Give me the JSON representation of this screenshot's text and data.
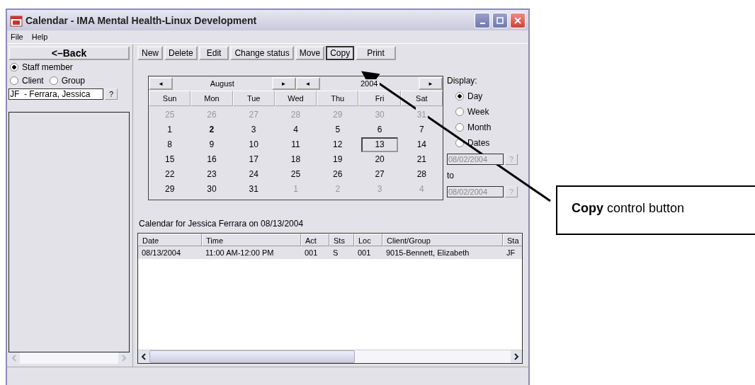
{
  "window": {
    "title": "Calendar - IMA Mental Health-Linux Development"
  },
  "menu": [
    "File",
    "Help"
  ],
  "back_button": "<–Back",
  "toolbar": [
    {
      "label": "New",
      "selected": false
    },
    {
      "label": "Delete",
      "selected": false
    },
    {
      "label": "Edit",
      "selected": false
    },
    {
      "label": "Change status",
      "selected": false
    },
    {
      "label": "Move",
      "selected": false
    },
    {
      "label": "Copy",
      "selected": true
    },
    {
      "label": "Print",
      "selected": false
    }
  ],
  "mode_options": [
    {
      "label": "Staff member",
      "selected": true
    },
    {
      "label": "Client",
      "selected": false
    },
    {
      "label": "Group",
      "selected": false
    }
  ],
  "person_field": {
    "value": "JF  - Ferrara, Jessica",
    "lookup": "?"
  },
  "calendar": {
    "month": "August",
    "year": "2004",
    "prev": "◄",
    "next": "►",
    "weekdays": [
      "Sun",
      "Mon",
      "Tue",
      "Wed",
      "Thu",
      "Fri",
      "Sat"
    ],
    "weeks": [
      [
        {
          "text": "25",
          "kind": "other",
          "selected": false
        },
        {
          "text": "26",
          "kind": "other",
          "selected": false
        },
        {
          "text": "27",
          "kind": "other",
          "selected": false
        },
        {
          "text": "28",
          "kind": "other",
          "selected": false
        },
        {
          "text": "29",
          "kind": "other",
          "selected": false
        },
        {
          "text": "30",
          "kind": "other",
          "selected": false
        },
        {
          "text": "31",
          "kind": "other",
          "selected": false
        }
      ],
      [
        {
          "text": "1",
          "kind": "normal",
          "selected": false
        },
        {
          "text": "2",
          "kind": "today",
          "selected": false
        },
        {
          "text": "3",
          "kind": "normal",
          "selected": false
        },
        {
          "text": "4",
          "kind": "normal",
          "selected": false
        },
        {
          "text": "5",
          "kind": "normal",
          "selected": false
        },
        {
          "text": "6",
          "kind": "normal",
          "selected": false
        },
        {
          "text": "7",
          "kind": "normal",
          "selected": false
        }
      ],
      [
        {
          "text": "8",
          "kind": "normal",
          "selected": false
        },
        {
          "text": "9",
          "kind": "normal",
          "selected": false
        },
        {
          "text": "10",
          "kind": "normal",
          "selected": false
        },
        {
          "text": "11",
          "kind": "normal",
          "selected": false
        },
        {
          "text": "12",
          "kind": "normal",
          "selected": false
        },
        {
          "text": "13",
          "kind": "normal",
          "selected": true
        },
        {
          "text": "14",
          "kind": "normal",
          "selected": false
        }
      ],
      [
        {
          "text": "15",
          "kind": "normal",
          "selected": false
        },
        {
          "text": "16",
          "kind": "normal",
          "selected": false
        },
        {
          "text": "17",
          "kind": "normal",
          "selected": false
        },
        {
          "text": "18",
          "kind": "normal",
          "selected": false
        },
        {
          "text": "19",
          "kind": "normal",
          "selected": false
        },
        {
          "text": "20",
          "kind": "normal",
          "selected": false
        },
        {
          "text": "21",
          "kind": "normal",
          "selected": false
        }
      ],
      [
        {
          "text": "22",
          "kind": "normal",
          "selected": false
        },
        {
          "text": "23",
          "kind": "normal",
          "selected": false
        },
        {
          "text": "24",
          "kind": "normal",
          "selected": false
        },
        {
          "text": "25",
          "kind": "normal",
          "selected": false
        },
        {
          "text": "26",
          "kind": "normal",
          "selected": false
        },
        {
          "text": "27",
          "kind": "normal",
          "selected": false
        },
        {
          "text": "28",
          "kind": "normal",
          "selected": false
        }
      ],
      [
        {
          "text": "29",
          "kind": "normal",
          "selected": false
        },
        {
          "text": "30",
          "kind": "normal",
          "selected": false
        },
        {
          "text": "31",
          "kind": "normal",
          "selected": false
        },
        {
          "text": "1",
          "kind": "other",
          "selected": false
        },
        {
          "text": "2",
          "kind": "other",
          "selected": false
        },
        {
          "text": "3",
          "kind": "other",
          "selected": false
        },
        {
          "text": "4",
          "kind": "other",
          "selected": false
        }
      ]
    ]
  },
  "display": {
    "label": "Display:",
    "options": [
      {
        "label": "Day",
        "selected": true
      },
      {
        "label": "Week",
        "selected": false
      },
      {
        "label": "Month",
        "selected": false
      },
      {
        "label": "Dates",
        "selected": false
      }
    ],
    "from": {
      "value": "08/02/2004",
      "lookup": "?",
      "disabled": true
    },
    "to_label": "to",
    "to": {
      "value": "08/02/2004",
      "lookup": "?",
      "disabled": true
    }
  },
  "schedule": {
    "caption": "Calendar for Jessica Ferrara on 08/13/2004",
    "columns": [
      "Date",
      "Time",
      "Act",
      "Sts",
      "Loc",
      "Client/Group",
      "Sta"
    ],
    "rows": [
      [
        "08/13/2004",
        "11:00 AM-12:00 PM",
        "001",
        "S",
        "001",
        "9015-Bennett, Elizabeth",
        "JF"
      ]
    ]
  },
  "callout": {
    "text": "**Copy** control button"
  }
}
